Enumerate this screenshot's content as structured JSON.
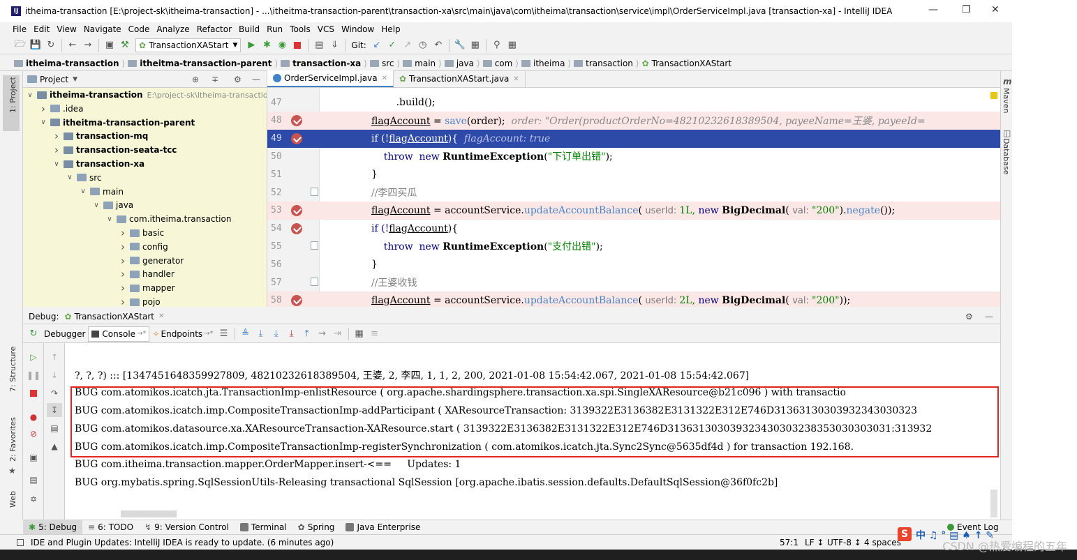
{
  "window": {
    "title": "itheima-transaction [E:\\project-sk\\itheima-transaction] - ...\\itheitma-transaction-parent\\transaction-xa\\src\\main\\java\\com\\itheima\\transaction\\service\\impl\\OrderServiceImpl.java [transaction-xa] - IntelliJ IDEA",
    "logo": "IJ"
  },
  "menu": [
    "File",
    "Edit",
    "View",
    "Navigate",
    "Code",
    "Analyze",
    "Refactor",
    "Build",
    "Run",
    "Tools",
    "VCS",
    "Window",
    "Help"
  ],
  "toolbar": {
    "run_config": "TransactionXAStart",
    "git_label": "Git:"
  },
  "breadcrumbs": [
    "itheima-transaction",
    "itheitma-transaction-parent",
    "transaction-xa",
    "src",
    "main",
    "java",
    "itheima",
    "com",
    "transaction",
    "TransactionXAStart"
  ],
  "left_stripe": {
    "project": "1: Project",
    "structure": "7: Structure",
    "favorites": "2: Favorites",
    "web": "Web"
  },
  "right_stripe": {
    "maven": "Maven",
    "database": "Database"
  },
  "project": {
    "header": "Project",
    "rows": [
      {
        "label": "itheima-transaction",
        "extra": "E:\\project-sk\\itheima-transaction",
        "indent": 0,
        "arrow": "v",
        "bold": true
      },
      {
        "label": ".idea",
        "indent": 1,
        "arrow": ">",
        "bold": false
      },
      {
        "label": "itheitma-transaction-parent",
        "indent": 1,
        "arrow": "v",
        "bold": true
      },
      {
        "label": "transaction-mq",
        "indent": 2,
        "arrow": ">",
        "bold": true
      },
      {
        "label": "transaction-seata-tcc",
        "indent": 2,
        "arrow": ">",
        "bold": true
      },
      {
        "label": "transaction-xa",
        "indent": 2,
        "arrow": "v",
        "bold": true
      },
      {
        "label": "src",
        "indent": 3,
        "arrow": "v",
        "bold": false
      },
      {
        "label": "main",
        "indent": 4,
        "arrow": "v",
        "bold": false
      },
      {
        "label": "java",
        "indent": 5,
        "arrow": "v",
        "bold": false
      },
      {
        "label": "com.itheima.transaction",
        "indent": 6,
        "arrow": "v",
        "bold": false
      },
      {
        "label": "basic",
        "indent": 7,
        "arrow": ">",
        "bold": false
      },
      {
        "label": "config",
        "indent": 7,
        "arrow": ">",
        "bold": false
      },
      {
        "label": "generator",
        "indent": 7,
        "arrow": ">",
        "bold": false
      },
      {
        "label": "handler",
        "indent": 7,
        "arrow": ">",
        "bold": false
      },
      {
        "label": "mapper",
        "indent": 7,
        "arrow": ">",
        "bold": false
      },
      {
        "label": "pojo",
        "indent": 7,
        "arrow": ">",
        "bold": false
      }
    ]
  },
  "editor": {
    "tabs": [
      {
        "label": "OrderServiceImpl.java",
        "active": true
      },
      {
        "label": "TransactionXAStart.java",
        "active": false
      }
    ],
    "lines": [
      {
        "num": "47",
        "bp": false,
        "hl": "none",
        "segs": [
          {
            "t": "        .build();",
            "c": ""
          }
        ]
      },
      {
        "num": "48",
        "bp": true,
        "hl": "pink",
        "segs": [
          {
            "t": "flagAccount",
            "c": "u"
          },
          {
            "t": " = ",
            "c": ""
          },
          {
            "t": "save",
            "c": "meth"
          },
          {
            "t": "(order);  ",
            "c": ""
          },
          {
            "t": "order: \"Order(productOrderNo=48210232618389504, payeeName=王婆, payeeId=",
            "c": "dbgval"
          }
        ]
      },
      {
        "num": "49",
        "bp": true,
        "hl": "blue",
        "segs": [
          {
            "t": "if (!",
            "c": ""
          },
          {
            "t": "flagAccount",
            "c": "u"
          },
          {
            "t": "){  ",
            "c": ""
          },
          {
            "t": "flagAccount: true",
            "c": "dbgval"
          }
        ]
      },
      {
        "num": "50",
        "bp": false,
        "hl": "none",
        "segs": [
          {
            "t": "    throw  new ",
            "c": "kw"
          },
          {
            "t": "RuntimeException",
            "c": "cls"
          },
          {
            "t": "(",
            "c": ""
          },
          {
            "t": "\"下订单出错\"",
            "c": "str"
          },
          {
            "t": ");",
            "c": ""
          }
        ]
      },
      {
        "num": "51",
        "bp": false,
        "hl": "none",
        "segs": [
          {
            "t": "}",
            "c": ""
          }
        ]
      },
      {
        "num": "52",
        "bp": false,
        "hl": "none",
        "segs": [
          {
            "t": "//李四买瓜",
            "c": "comm"
          }
        ]
      },
      {
        "num": "53",
        "bp": true,
        "hl": "pink",
        "segs": [
          {
            "t": "flagAccount",
            "c": "u"
          },
          {
            "t": " = accountService.",
            "c": ""
          },
          {
            "t": "updateAccountBalance",
            "c": "meth"
          },
          {
            "t": "( ",
            "c": ""
          },
          {
            "t": "userId: ",
            "c": "inlay"
          },
          {
            "t": "1L, ",
            "c": "str"
          },
          {
            "t": "new ",
            "c": "kw"
          },
          {
            "t": "BigDecimal",
            "c": "cls"
          },
          {
            "t": "( ",
            "c": ""
          },
          {
            "t": "val: ",
            "c": "inlay"
          },
          {
            "t": "\"200\"",
            "c": "str"
          },
          {
            "t": ").",
            "c": ""
          },
          {
            "t": "negate",
            "c": "meth"
          },
          {
            "t": "());",
            "c": ""
          }
        ]
      },
      {
        "num": "54",
        "bp": true,
        "hl": "none",
        "segs": [
          {
            "t": "if (!",
            "c": "kw"
          },
          {
            "t": "flagAccount",
            "c": "u"
          },
          {
            "t": "){",
            "c": ""
          }
        ]
      },
      {
        "num": "55",
        "bp": false,
        "hl": "none",
        "segs": [
          {
            "t": "    throw  new ",
            "c": "kw"
          },
          {
            "t": "RuntimeException",
            "c": "cls"
          },
          {
            "t": "(",
            "c": ""
          },
          {
            "t": "\"支付出错\"",
            "c": "str"
          },
          {
            "t": ");",
            "c": ""
          }
        ]
      },
      {
        "num": "56",
        "bp": false,
        "hl": "none",
        "segs": [
          {
            "t": "}",
            "c": ""
          }
        ]
      },
      {
        "num": "57",
        "bp": false,
        "hl": "none",
        "segs": [
          {
            "t": "//王婆收钱",
            "c": "comm"
          }
        ]
      },
      {
        "num": "58",
        "bp": true,
        "hl": "pink",
        "segs": [
          {
            "t": "flagAccount",
            "c": "u"
          },
          {
            "t": " = accountService.",
            "c": ""
          },
          {
            "t": "updateAccountBalance",
            "c": "meth"
          },
          {
            "t": "( ",
            "c": ""
          },
          {
            "t": "userId: ",
            "c": "inlay"
          },
          {
            "t": "2L, ",
            "c": "str"
          },
          {
            "t": "new ",
            "c": "kw"
          },
          {
            "t": "BigDecimal",
            "c": "cls"
          },
          {
            "t": "( ",
            "c": ""
          },
          {
            "t": "val: ",
            "c": "inlay"
          },
          {
            "t": "\"200\"",
            "c": "str"
          },
          {
            "t": "));",
            "c": ""
          }
        ]
      }
    ]
  },
  "debug": {
    "label": "Debug:",
    "session": "TransactionXAStart",
    "tabs": {
      "debugger": "Debugger",
      "console": "Console",
      "endpoints": "Endpoints"
    },
    "console_lines": [
      "?, ?, ?) ::: [1347451648359927809, 48210232618389504, 王婆, 2, 李四, 1, 1, 2, 200, 2021-01-08 15:54:42.067, 2021-01-08 15:54:42.067]",
      "BUG com.atomikos.icatch.jta.TransactionImp-enlistResource ( org.apache.shardingsphere.transaction.xa.spi.SingleXAResource@b21c096 ) with transactio",
      "BUG com.atomikos.icatch.imp.CompositeTransactionImp-addParticipant ( XAResourceTransaction: 3139322E3136382E3131322E312E746D31363130303932343030323",
      "BUG com.atomikos.datasource.xa.XAResourceTransaction-XAResource.start ( 3139322E3136382E3131322E312E746D313631303039323430303238353030303031:313932",
      "BUG com.atomikos.icatch.imp.CompositeTransactionImp-registerSynchronization ( com.atomikos.icatch.jta.Sync2Sync@5635df4d ) for transaction 192.168.",
      "BUG com.itheima.transaction.mapper.OrderMapper.insert-<==     Updates: 1",
      "BUG org.mybatis.spring.SqlSessionUtils-Releasing transactional SqlSession [org.apache.ibatis.session.defaults.DefaultSqlSession@36f0fc2b]"
    ]
  },
  "bottom_tabs": [
    "5: Debug",
    "6: TODO",
    "9: Version Control",
    "Terminal",
    "Spring",
    "Java Enterprise"
  ],
  "event_log": "Event Log",
  "status": {
    "message": "IDE and Plugin Updates: IntelliJ IDEA is ready to update. (6 minutes ago)",
    "position": "57:1",
    "line_sep": "LF",
    "encoding": "UTF-8",
    "indent": "4 spaces"
  },
  "watermark": "CSDN @热爱编程的五年",
  "ime_label": "中"
}
